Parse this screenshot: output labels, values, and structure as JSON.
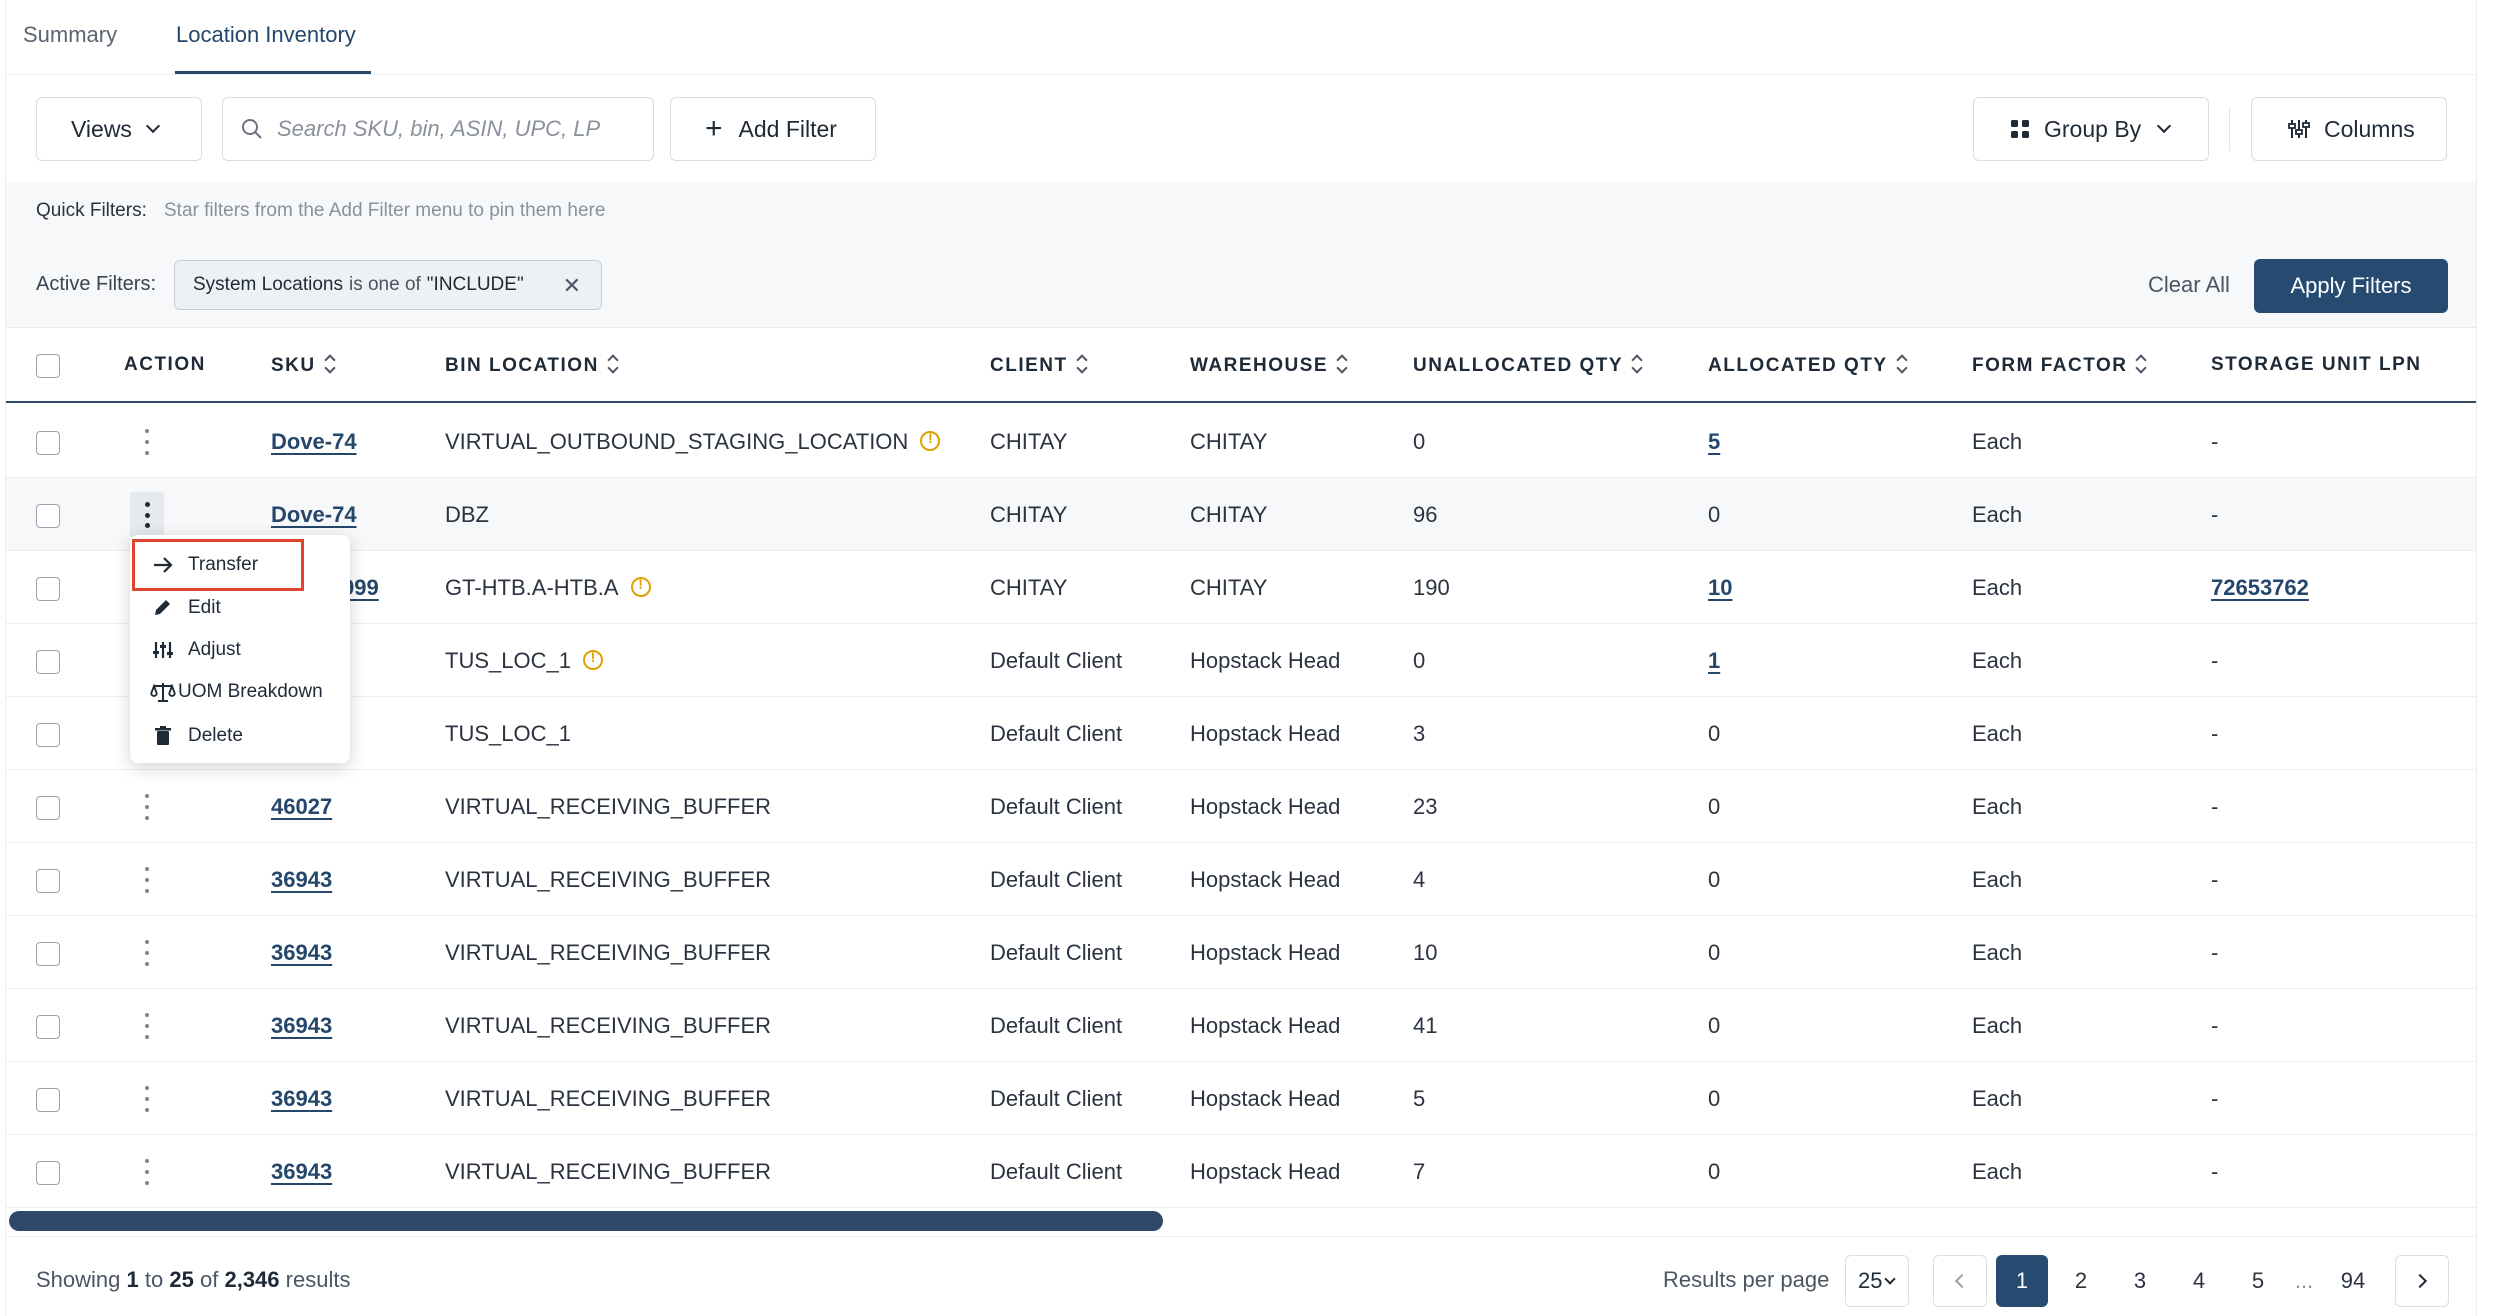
{
  "tabs": [
    {
      "label": "Summary"
    },
    {
      "label": "Location Inventory",
      "active": true
    }
  ],
  "toolbar": {
    "views_label": "Views",
    "search_placeholder": "Search SKU, bin, ASIN, UPC, LP",
    "add_filter_label": "Add Filter",
    "group_by_label": "Group By",
    "columns_label": "Columns"
  },
  "filters": {
    "quick_label": "Quick Filters:",
    "quick_hint": "Star filters from the Add Filter menu to pin them here",
    "active_label": "Active Filters:",
    "chip": {
      "field": "System Locations",
      "op": "is one of",
      "value": "\"INCLUDE\""
    },
    "clear_all": "Clear All",
    "apply": "Apply Filters"
  },
  "table": {
    "headers": {
      "action": "ACTION",
      "sku": "SKU",
      "bin": "BIN LOCATION",
      "client": "CLIENT",
      "warehouse": "WAREHOUSE",
      "unalloc": "UNALLOCATED QTY",
      "alloc": "ALLOCATED QTY",
      "form": "FORM FACTOR",
      "lpn": "STORAGE UNIT LPN"
    },
    "rows": [
      {
        "sku": "Dove-74",
        "bin": "VIRTUAL_OUTBOUND_STAGING_LOCATION",
        "client": "CHITAY",
        "warehouse": "CHITAY",
        "unalloc": "0",
        "alloc": "5",
        "form": "Each",
        "lpn": "-"
      },
      {
        "sku": "Dove-74",
        "bin": "DBZ",
        "client": "CHITAY",
        "warehouse": "CHITAY",
        "unalloc": "96",
        "alloc": "0",
        "form": "Each",
        "lpn": "-"
      },
      {
        "sku": "999",
        "bin": "GT-HTB.A-HTB.A",
        "client": "CHITAY",
        "warehouse": "CHITAY",
        "unalloc": "190",
        "alloc": "10",
        "form": "Each",
        "lpn": "72653762"
      },
      {
        "sku": "",
        "bin": "TUS_LOC_1",
        "client": "Default Client",
        "warehouse": "Hopstack Head",
        "unalloc": "0",
        "alloc": "1",
        "form": "Each",
        "lpn": "-"
      },
      {
        "sku": "",
        "bin": "TUS_LOC_1",
        "client": "Default Client",
        "warehouse": "Hopstack Head",
        "unalloc": "3",
        "alloc": "0",
        "form": "Each",
        "lpn": "-"
      },
      {
        "sku": "46027",
        "bin": "VIRTUAL_RECEIVING_BUFFER",
        "client": "Default Client",
        "warehouse": "Hopstack Head",
        "unalloc": "23",
        "alloc": "0",
        "form": "Each",
        "lpn": "-"
      },
      {
        "sku": "36943",
        "bin": "VIRTUAL_RECEIVING_BUFFER",
        "client": "Default Client",
        "warehouse": "Hopstack Head",
        "unalloc": "4",
        "alloc": "0",
        "form": "Each",
        "lpn": "-"
      },
      {
        "sku": "36943",
        "bin": "VIRTUAL_RECEIVING_BUFFER",
        "client": "Default Client",
        "warehouse": "Hopstack Head",
        "unalloc": "10",
        "alloc": "0",
        "form": "Each",
        "lpn": "-"
      },
      {
        "sku": "36943",
        "bin": "VIRTUAL_RECEIVING_BUFFER",
        "client": "Default Client",
        "warehouse": "Hopstack Head",
        "unalloc": "41",
        "alloc": "0",
        "form": "Each",
        "lpn": "-"
      },
      {
        "sku": "36943",
        "bin": "VIRTUAL_RECEIVING_BUFFER",
        "client": "Default Client",
        "warehouse": "Hopstack Head",
        "unalloc": "5",
        "alloc": "0",
        "form": "Each",
        "lpn": "-"
      },
      {
        "sku": "36943",
        "bin": "VIRTUAL_RECEIVING_BUFFER",
        "client": "Default Client",
        "warehouse": "Hopstack Head",
        "unalloc": "7",
        "alloc": "0",
        "form": "Each",
        "lpn": "-"
      }
    ]
  },
  "menu": {
    "items": [
      {
        "label": "Transfer",
        "icon": "arrow-right-icon"
      },
      {
        "label": "Edit",
        "icon": "pencil-icon"
      },
      {
        "label": "Adjust",
        "icon": "sliders-icon"
      },
      {
        "label": "UOM Breakdown",
        "icon": "scale-icon"
      },
      {
        "label": "Delete",
        "icon": "trash-icon"
      }
    ]
  },
  "footer": {
    "showing_prefix": "Showing",
    "from": "1",
    "to_word": "to",
    "to": "25",
    "of_word": "of",
    "total": "2,346",
    "results_word": "results",
    "rpp_label": "Results per page",
    "rpp_value": "25",
    "pages": [
      "1",
      "2",
      "3",
      "4",
      "5",
      "...",
      "94"
    ]
  },
  "colors": {
    "accent": "#264a70",
    "link": "#24476b",
    "highlight": "#e0442e",
    "warn": "#e0a100"
  }
}
